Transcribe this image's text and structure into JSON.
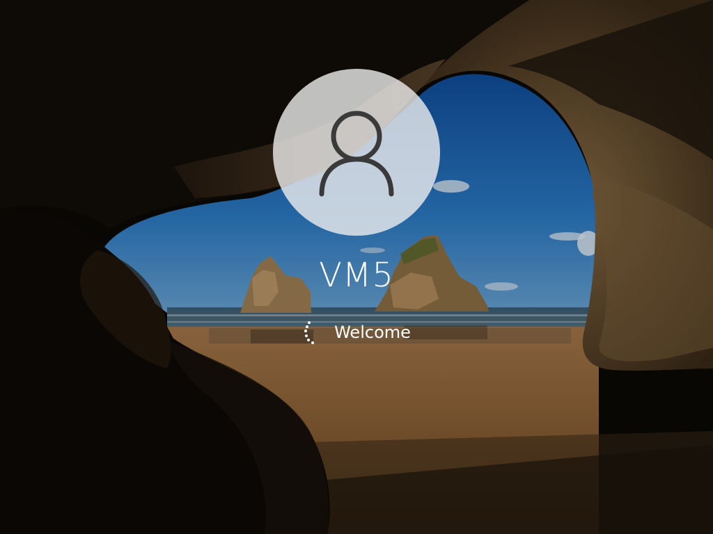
{
  "account": {
    "username": "VM5",
    "avatar_icon": "user-icon"
  },
  "status": {
    "text": "Welcome",
    "spinner_icon": "loading-spinner-icon"
  },
  "colors": {
    "text": "#ffffff",
    "avatar_background": "#eeeeee",
    "avatar_glyph": "#3a3a3a",
    "sky": "#1e6cc0",
    "sand": "#8a5e33",
    "cave": "#0c0906"
  }
}
